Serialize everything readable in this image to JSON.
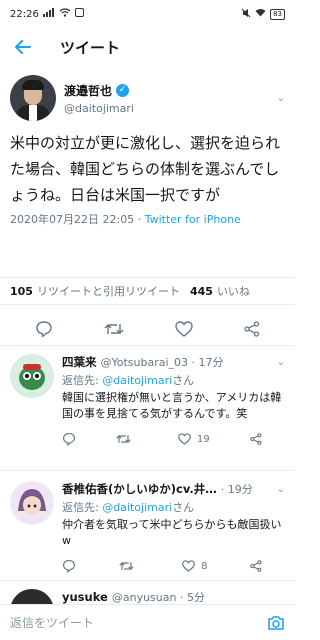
{
  "status_bar": {
    "time": "22:26",
    "battery": "83"
  },
  "header": {
    "title": "ツイート"
  },
  "main_tweet": {
    "author_name": "渡邉哲也",
    "author_handle": "@daitojimari",
    "text": "米中の対立が更に激化し、選択を迫られた場合、韓国どちらの体制を選ぶんでしょうね。日台は米国一択ですが",
    "datetime": "2020年07月22日 22:05",
    "source": "Twitter for iPhone"
  },
  "stats": {
    "retweets": "105",
    "retweets_label": "リツイートと引用リツイート",
    "likes": "445",
    "likes_label": "いいね"
  },
  "replies": [
    {
      "name": "四葉来",
      "handle": "@Yotsubarai_03 · 17分",
      "reply_prefix": "返信先: ",
      "reply_to": "@daitojimari",
      "reply_suffix": "さん",
      "text": "韓国に選択権が無いと言うか、アメリカは韓国の事を見捨てる気がするんです。笑",
      "retweets": "",
      "likes": "19"
    },
    {
      "name": "香椎佑香(かしいゆか)cv.井…",
      "handle": "· 19分",
      "reply_prefix": "返信先: ",
      "reply_to": "@daitojimari",
      "reply_suffix": "さん",
      "text": "仲介者を気取って米中どちらからも敵国扱いw",
      "retweets": "",
      "likes": "8"
    },
    {
      "name": "yusuke",
      "handle": "@anyusuan · 5分",
      "reply_prefix": "",
      "reply_to": "",
      "reply_suffix": "",
      "text": "",
      "retweets": "",
      "likes": ""
    }
  ],
  "compose": {
    "placeholder": "返信をツイート"
  },
  "colors": {
    "accent": "#1da1f2",
    "muted": "#657786",
    "border": "#e6ecf0"
  },
  "icons": [
    "back-arrow-icon",
    "verified-icon",
    "reply-icon",
    "retweet-icon",
    "like-icon",
    "share-icon",
    "camera-icon"
  ]
}
